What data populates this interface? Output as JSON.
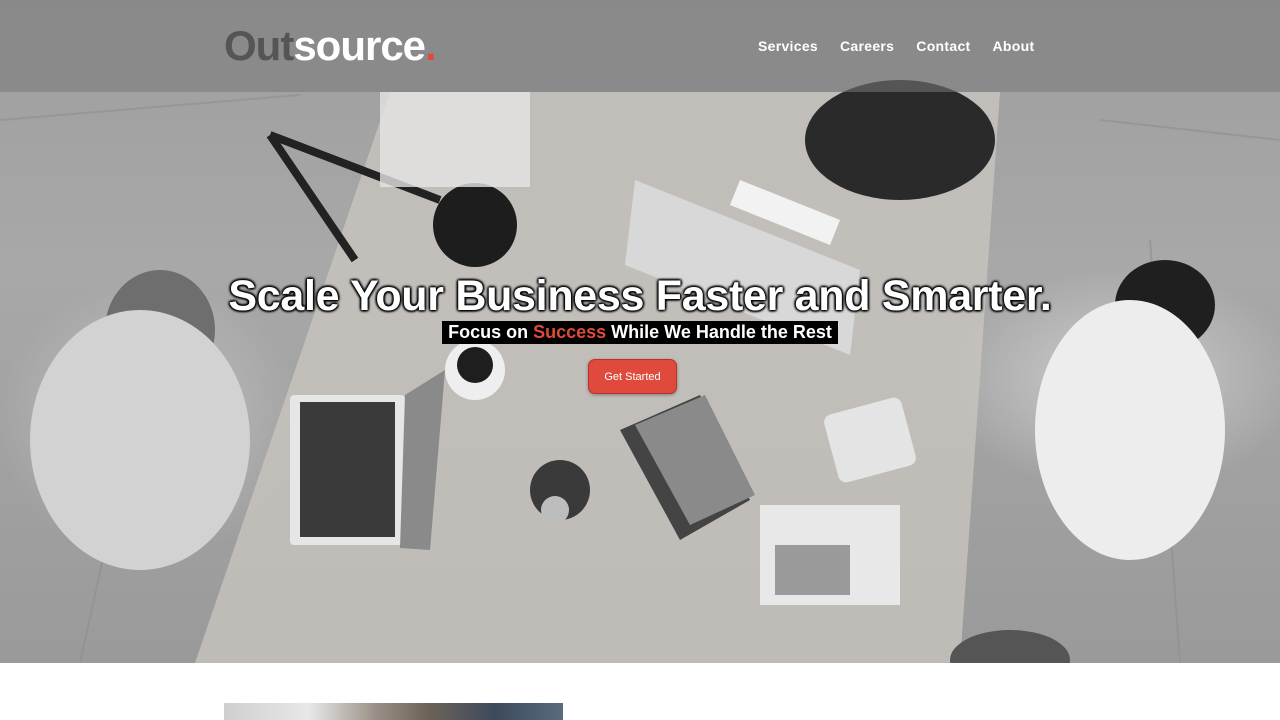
{
  "brand": {
    "logo_part1": "Out",
    "logo_part2": "source",
    "logo_dot": ".",
    "accent_color": "#e04a3c"
  },
  "nav": {
    "items": [
      "Services",
      "Careers",
      "Contact",
      "About"
    ]
  },
  "hero": {
    "headline": "Scale Your Business Faster and Smarter.",
    "subline_part1": "Focus on ",
    "subline_accent": "Success",
    "subline_part2": " While We Handle the Rest",
    "cta_label": "Get Started",
    "background": "office-meeting-photo"
  }
}
